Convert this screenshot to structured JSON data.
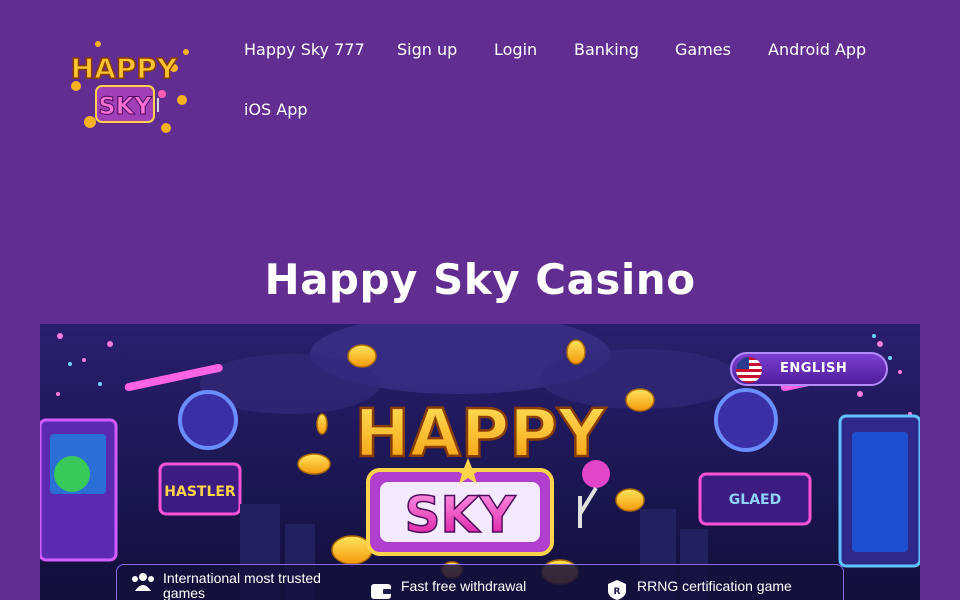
{
  "site": {
    "logo": {
      "line1": "HAPPY",
      "line2": "SKY"
    },
    "nav": [
      {
        "label": "Happy Sky 777"
      },
      {
        "label": "Sign up"
      },
      {
        "label": "Login"
      },
      {
        "label": "Banking"
      },
      {
        "label": "Games"
      },
      {
        "label": "Android App"
      },
      {
        "label": "iOS App"
      }
    ]
  },
  "main": {
    "title": "Happy Sky Casino",
    "banner": {
      "logo_line1": "HAPPY",
      "logo_line2": "SKY",
      "language_button": "ENGLISH",
      "features": [
        {
          "icon": "users-icon",
          "label": "International most trusted games"
        },
        {
          "icon": "wallet-icon",
          "label": "Fast free withdrawal"
        },
        {
          "icon": "certificate-icon",
          "label": "RRNG certification game"
        }
      ]
    }
  },
  "colors": {
    "background": "#622d91",
    "text": "#ffffff",
    "banner_bg": "#1c1a52",
    "accent_gold": "#ffc531",
    "accent_pink": "#e246c8"
  }
}
